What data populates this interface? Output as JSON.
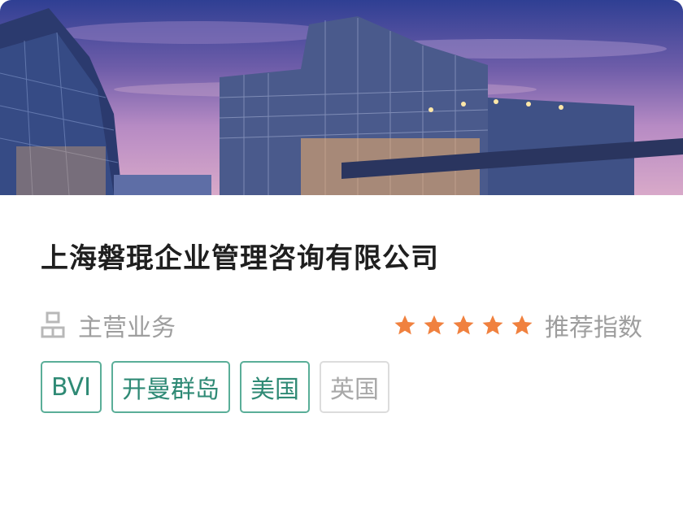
{
  "company": {
    "name": "上海磐琨企业管理咨询有限公司"
  },
  "business": {
    "icon": "org-chart-icon",
    "label": "主营业务"
  },
  "rating": {
    "stars": 5,
    "max_stars": 5,
    "label": "推荐指数",
    "star_color": "#f0813f"
  },
  "tags": [
    {
      "label": "BVI",
      "active": true
    },
    {
      "label": "开曼群岛",
      "active": true
    },
    {
      "label": "美国",
      "active": true
    },
    {
      "label": "英国",
      "active": false
    }
  ],
  "colors": {
    "tag_active_border": "#5aae98",
    "tag_active_text": "#2f8a75",
    "tag_inactive_border": "#dcdcdc",
    "tag_inactive_text": "#a8a8a8"
  }
}
